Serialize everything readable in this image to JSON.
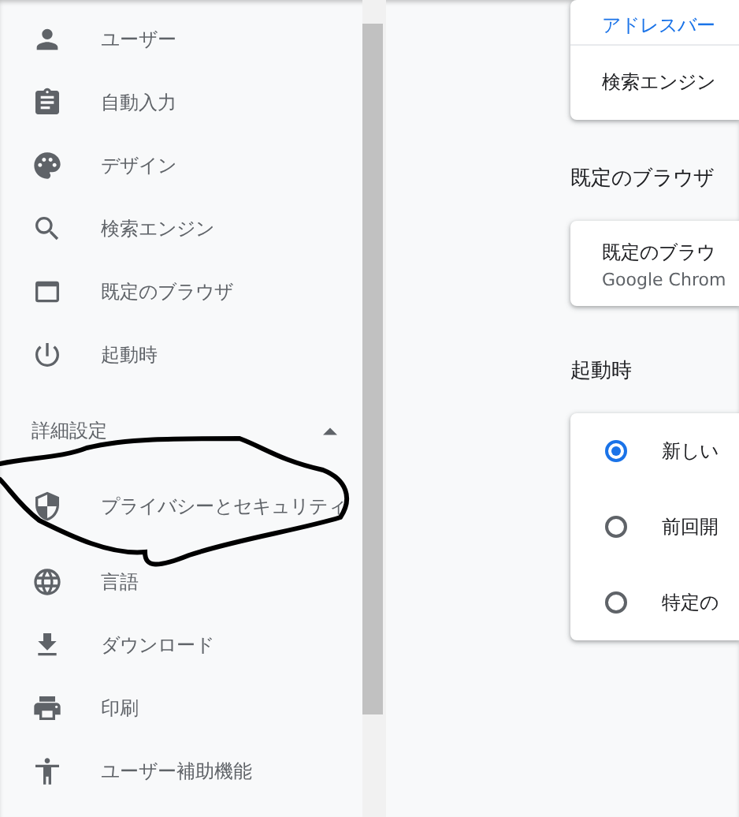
{
  "sidebar": {
    "items": [
      {
        "label": "ユーザー",
        "selected": false
      },
      {
        "label": "自動入力",
        "selected": false
      },
      {
        "label": "デザイン",
        "selected": false
      },
      {
        "label": "検索エンジン",
        "selected": false
      },
      {
        "label": "既定のブラウザ",
        "selected": false
      },
      {
        "label": "起動時",
        "selected": false
      }
    ],
    "advanced": {
      "label": "詳細設定",
      "expanded": true,
      "items": [
        {
          "label": "プライバシーとセキュリティ",
          "selected": false
        },
        {
          "label": "言語",
          "selected": false
        },
        {
          "label": "ダウンロード",
          "selected": false
        },
        {
          "label": "印刷",
          "selected": false
        },
        {
          "label": "ユーザー補助機能",
          "selected": false
        }
      ]
    }
  },
  "main": {
    "search_card": {
      "rows": [
        "アドレスバー",
        "検索エンジン"
      ]
    },
    "default_browser": {
      "heading": "既定のブラウザ",
      "title": "既定のブラウ",
      "subtitle": "Google Chrom"
    },
    "startup": {
      "heading": "起動時",
      "options": [
        {
          "label": "新しい",
          "selected": true
        },
        {
          "label": "前回開",
          "selected": false
        },
        {
          "label": "特定の",
          "selected": false
        }
      ]
    }
  }
}
